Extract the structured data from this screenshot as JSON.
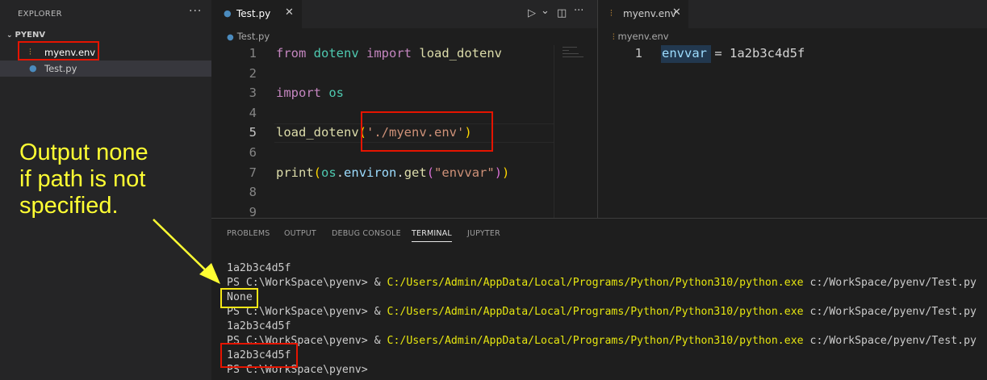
{
  "sidebar": {
    "title": "EXPLORER",
    "more": "···",
    "folder": "PYENV",
    "files": [
      {
        "name": "myenv.env",
        "icon": "settings-file-icon"
      },
      {
        "name": "Test.py",
        "icon": "python-file-icon"
      }
    ]
  },
  "editor_left": {
    "tab_label": "Test.py",
    "tab_close": "✕",
    "breadcrumb": "Test.py",
    "lines": [
      "1",
      "2",
      "3",
      "4",
      "5",
      "6",
      "7",
      "8",
      "9"
    ],
    "code": {
      "l1_from": "from",
      "l1_mod": "dotenv",
      "l1_import": "import",
      "l1_fn": "load_dotenv",
      "l3_import": "import",
      "l3_mod": "os",
      "l5_fn": "load_dotenv",
      "l5_open": "(",
      "l5_str": "'./myenv.env'",
      "l5_close": ")",
      "l7_fn": "print",
      "l7_open": "(",
      "l7_mod": "os",
      "l7_dot1": ".",
      "l7_attr": "environ",
      "l7_dot2": ".",
      "l7_get": "get",
      "l7_open2": "(",
      "l7_str": "\"envvar\"",
      "l7_close2": ")",
      "l7_close": ")"
    },
    "actions": {
      "run": "▷",
      "run_dropdown": "⌄",
      "split": "◫",
      "more": "···"
    }
  },
  "editor_right": {
    "tab_label": "myenv.env",
    "tab_close": "✕",
    "breadcrumb": "myenv.env",
    "line": "1",
    "key": "envvar",
    "rest": " = 1a2b3c4d5f"
  },
  "panel": {
    "tabs": [
      "PROBLEMS",
      "OUTPUT",
      "DEBUG CONSOLE",
      "TERMINAL",
      "JUPYTER"
    ],
    "active_tab": "TERMINAL",
    "terminal": [
      {
        "a": "1a2b3c4d5f",
        "b": "",
        "c": ""
      },
      {
        "a": "PS C:\\WorkSpace\\pyenv> & ",
        "b": "C:/Users/Admin/AppData/Local/Programs/Python/Python310/python.exe",
        "c": " c:/WorkSpace/pyenv/Test.py"
      },
      {
        "a": "None",
        "b": "",
        "c": ""
      },
      {
        "a": "PS C:\\WorkSpace\\pyenv> & ",
        "b": "C:/Users/Admin/AppData/Local/Programs/Python/Python310/python.exe",
        "c": " c:/WorkSpace/pyenv/Test.py"
      },
      {
        "a": "1a2b3c4d5f",
        "b": "",
        "c": ""
      },
      {
        "a": "PS C:\\WorkSpace\\pyenv> & ",
        "b": "C:/Users/Admin/AppData/Local/Programs/Python/Python310/python.exe",
        "c": " c:/WorkSpace/pyenv/Test.py"
      },
      {
        "a": "1a2b3c4d5f",
        "b": "",
        "c": ""
      },
      {
        "a": "PS C:\\WorkSpace\\pyenv>",
        "b": "",
        "c": ""
      }
    ]
  },
  "annotation": {
    "line1": "Output none",
    "line2": "if path is not",
    "line3": "specified."
  },
  "colors": {
    "highlight_red": "#e51400",
    "highlight_yellow": "#f5e716",
    "annotation_text": "#ffff33"
  }
}
